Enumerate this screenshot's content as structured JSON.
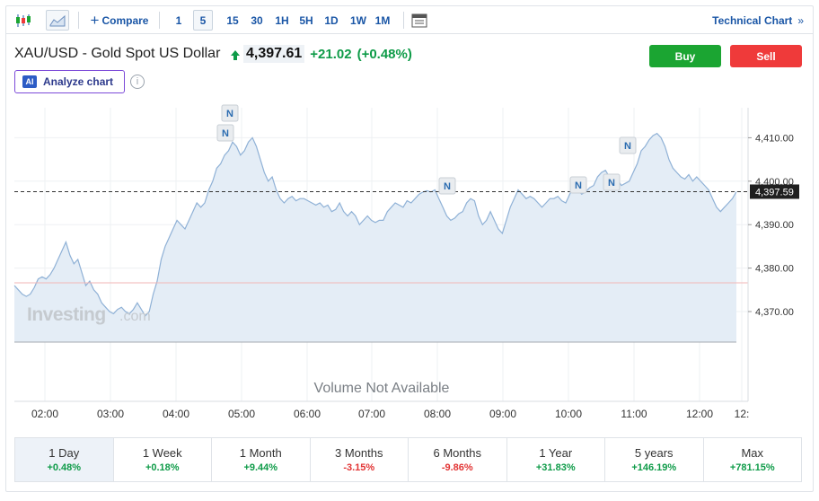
{
  "toolbar": {
    "compare_label": "Compare",
    "intervals": [
      "1",
      "5",
      "15",
      "30",
      "1H",
      "5H",
      "1D",
      "1W",
      "1M"
    ],
    "selected_interval": "5",
    "technical_chart_label": "Technical Chart"
  },
  "header": {
    "title": "XAU/USD - Gold Spot US Dollar",
    "price": "4,397.61",
    "change": "+21.02",
    "change_pct": "(+0.48%)",
    "buy_label": "Buy",
    "sell_label": "Sell",
    "analyze_label": "Analyze chart",
    "ai_badge": "AI",
    "info_icon": "i"
  },
  "chart_data": {
    "type": "area",
    "x_ticks": [
      "02:00",
      "03:00",
      "04:00",
      "05:00",
      "06:00",
      "07:00",
      "08:00",
      "09:00",
      "10:00",
      "11:00",
      "12:00",
      "12:"
    ],
    "y_ticks": [
      "4,410.00",
      "4,400.00",
      "4,390.00",
      "4,380.00",
      "4,370.00"
    ],
    "y_tick_values": [
      4410,
      4400,
      4390,
      4380,
      4370
    ],
    "ylim": [
      4363,
      4423
    ],
    "current_price_label": "4,397.59",
    "current_price": 4397.59,
    "previous_close": 4376.6,
    "series": [
      {
        "values": [
          4376,
          4375,
          4374,
          4373.5,
          4374,
          4375.5,
          4377.5,
          4378,
          4377.5,
          4378.5,
          4380,
          4382,
          4384,
          4386,
          4383,
          4381,
          4382,
          4379,
          4376,
          4377,
          4375,
          4374,
          4372,
          4371,
          4370,
          4369.5,
          4370.5,
          4371,
          4370,
          4369.5,
          4370.5,
          4372,
          4370.5,
          4369,
          4370,
          4374,
          4377,
          4382,
          4385,
          4387,
          4389,
          4391,
          4390,
          4389,
          4391,
          4393,
          4395,
          4394,
          4395,
          4398,
          4400,
          4403,
          4404,
          4406,
          4407,
          4409,
          4408,
          4406,
          4407,
          4409,
          4410,
          4408,
          4405,
          4402,
          4400,
          4401,
          4398,
          4396,
          4395,
          4396,
          4396.5,
          4395.5,
          4396,
          4396,
          4395.5,
          4395,
          4394.5,
          4395,
          4394,
          4394.5,
          4393,
          4393.5,
          4395,
          4393,
          4392,
          4393,
          4392,
          4390,
          4391,
          4392,
          4391,
          4390.5,
          4391,
          4391,
          4393,
          4394,
          4395,
          4394.5,
          4394,
          4395.5,
          4395,
          4396,
          4397,
          4397.5,
          4397.8,
          4397.5,
          4398,
          4396,
          4394,
          4392,
          4391,
          4391.5,
          4392.5,
          4393,
          4395,
          4396,
          4395.5,
          4392,
          4390,
          4391,
          4393,
          4391,
          4389,
          4388,
          4391,
          4394,
          4396,
          4398,
          4397,
          4396,
          4396.5,
          4396,
          4395,
          4394,
          4395,
          4396,
          4396,
          4396.5,
          4395.5,
          4395,
          4397,
          4399,
          4398,
          4397,
          4397.5,
          4398.5,
          4399,
          4401,
          4402,
          4402.5,
          4401,
          4400,
          4400.5,
          4399,
          4399.5,
          4400,
          4402,
          4404,
          4407,
          4408,
          4409.5,
          4410.5,
          4411,
          4410,
          4408,
          4405,
          4403,
          4402,
          4401,
          4400.5,
          4401.5,
          4400,
          4401,
          4400,
          4399,
          4398,
          4396,
          4394,
          4393,
          4394,
          4395,
          4396,
          4397.59
        ]
      }
    ],
    "news_markers": [
      "N",
      "N",
      "N",
      "N",
      "N",
      "N"
    ],
    "volume_text": "Volume Not Available",
    "watermark": "Investing",
    "watermark_suffix": ".com"
  },
  "ranges": [
    {
      "label": "1 Day",
      "pct": "+0.48%",
      "dir": "pos",
      "active": true
    },
    {
      "label": "1 Week",
      "pct": "+0.18%",
      "dir": "pos",
      "active": false
    },
    {
      "label": "1 Month",
      "pct": "+9.44%",
      "dir": "pos",
      "active": false
    },
    {
      "label": "3 Months",
      "pct": "-3.15%",
      "dir": "neg",
      "active": false
    },
    {
      "label": "6 Months",
      "pct": "-9.86%",
      "dir": "neg",
      "active": false
    },
    {
      "label": "1 Year",
      "pct": "+31.83%",
      "dir": "pos",
      "active": false
    },
    {
      "label": "5 years",
      "pct": "+146.19%",
      "dir": "pos",
      "active": false
    },
    {
      "label": "Max",
      "pct": "+781.15%",
      "dir": "pos",
      "active": false
    }
  ]
}
